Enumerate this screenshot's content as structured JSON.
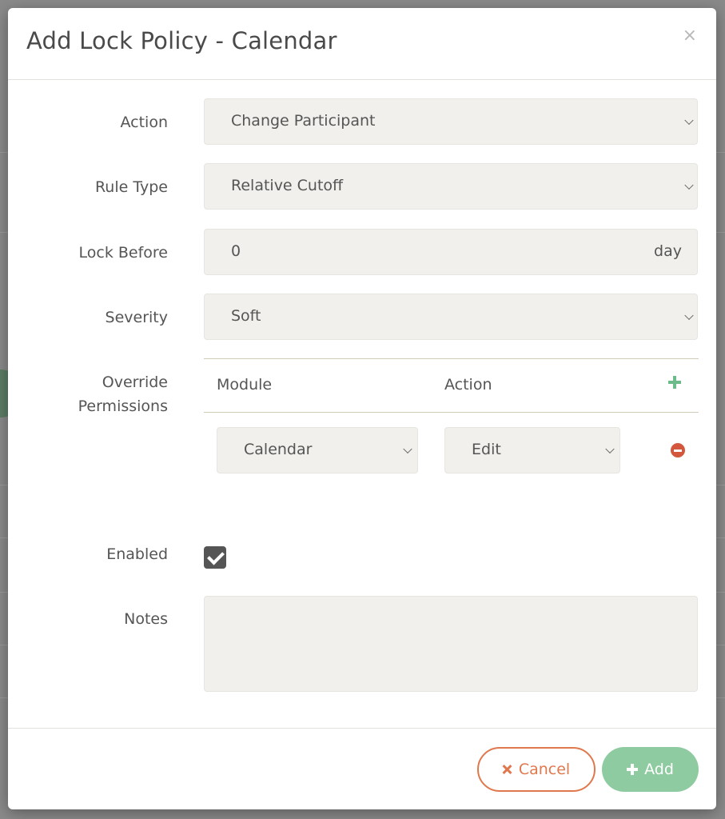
{
  "modal": {
    "title": "Add Lock Policy - Calendar",
    "close_label": "×"
  },
  "form": {
    "action": {
      "label": "Action",
      "value": "Change Participant"
    },
    "rule_type": {
      "label": "Rule Type",
      "value": "Relative Cutoff"
    },
    "lock_before": {
      "label": "Lock Before",
      "value": "0",
      "unit": "day"
    },
    "severity": {
      "label": "Severity",
      "value": "Soft"
    },
    "override_permissions": {
      "label_line1": "Override",
      "label_line2": "Permissions",
      "columns": {
        "module": "Module",
        "action": "Action"
      },
      "rows": [
        {
          "module": "Calendar",
          "action": "Edit"
        }
      ]
    },
    "enabled": {
      "label": "Enabled",
      "checked": true
    },
    "notes": {
      "label": "Notes",
      "value": ""
    }
  },
  "footer": {
    "cancel_label": "Cancel",
    "add_label": "Add"
  },
  "colors": {
    "accent_green": "#8fcba0",
    "plus_green": "#6dbb8a",
    "cancel_orange": "#e0784e",
    "remove_red": "#d3573c",
    "field_bg": "#f1f0ec"
  }
}
